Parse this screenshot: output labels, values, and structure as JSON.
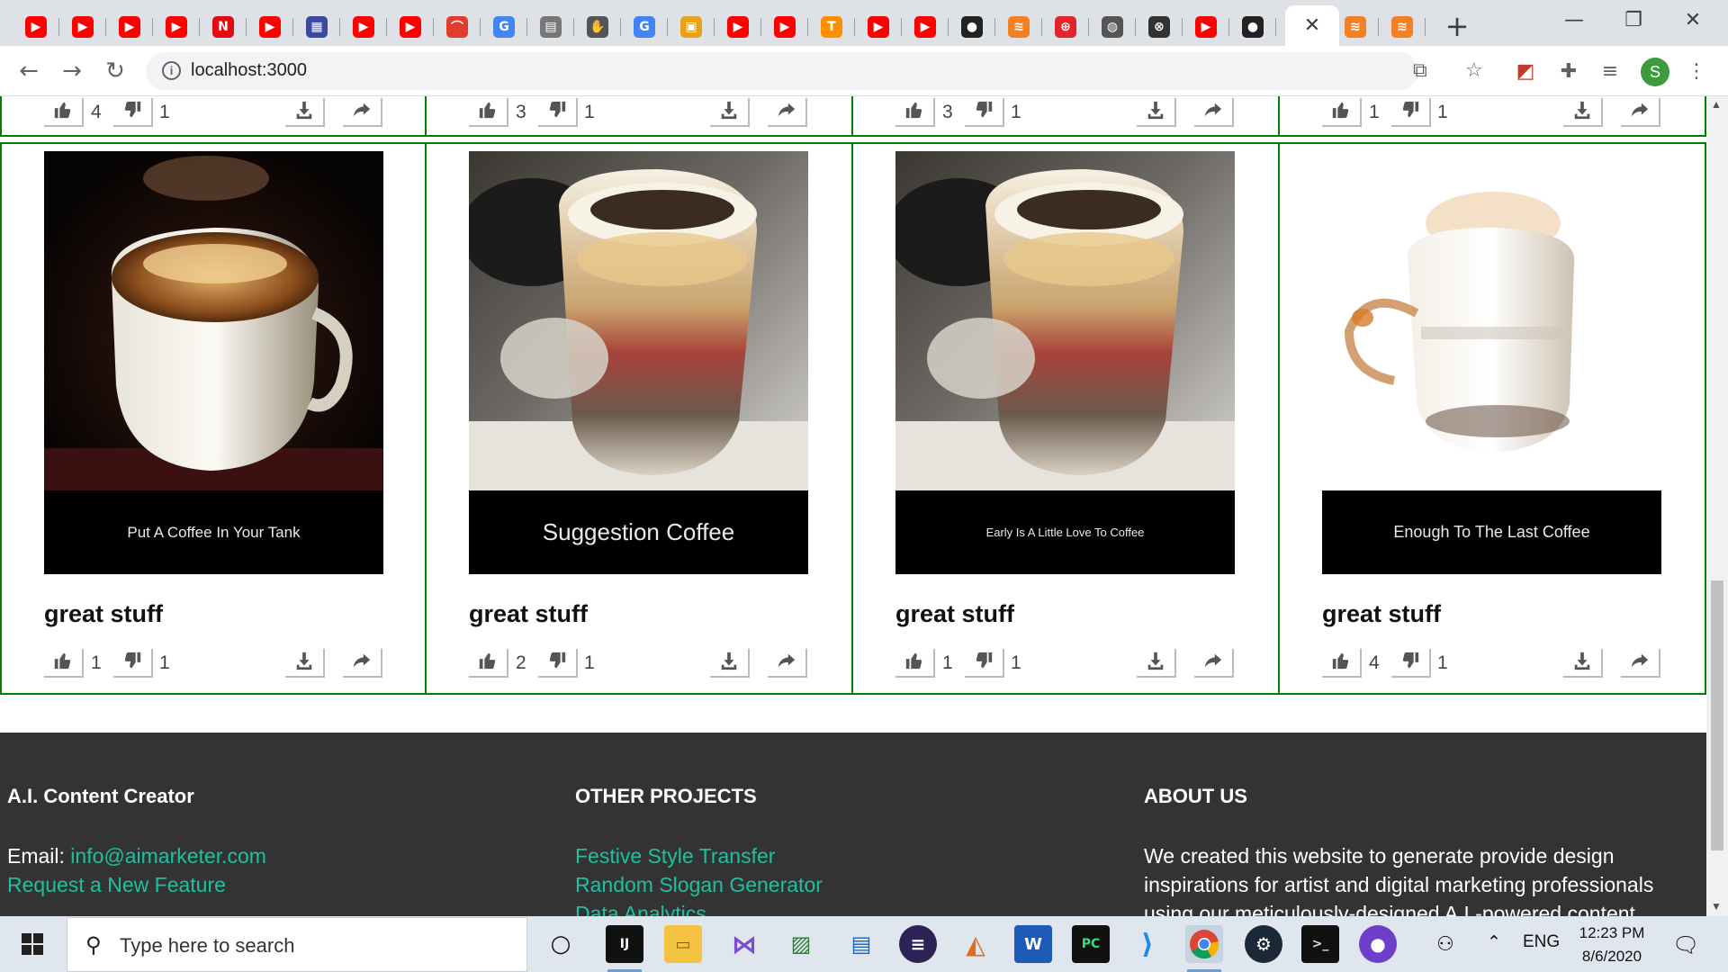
{
  "browser": {
    "tabs": [
      {
        "icon": "youtube-icon",
        "glyph": "▶",
        "color": "#ff0000"
      },
      {
        "icon": "youtube-icon",
        "glyph": "▶",
        "color": "#ff0000"
      },
      {
        "icon": "youtube-icon",
        "glyph": "▶",
        "color": "#ff0000"
      },
      {
        "icon": "youtube-icon",
        "glyph": "▶",
        "color": "#ff0000"
      },
      {
        "icon": "netflix-icon",
        "glyph": "N",
        "color": "#e50914"
      },
      {
        "icon": "youtube-icon",
        "glyph": "▶",
        "color": "#ff0000"
      },
      {
        "icon": "calendar-icon",
        "glyph": "▦",
        "color": "#3b4a9c"
      },
      {
        "icon": "youtube-icon",
        "glyph": "▶",
        "color": "#ff0000"
      },
      {
        "icon": "youtube-icon",
        "glyph": "▶",
        "color": "#ff0000"
      },
      {
        "icon": "bookmark-red-icon",
        "glyph": "⌒",
        "color": "#e33b2e"
      },
      {
        "icon": "google-icon",
        "glyph": "G",
        "color": "#4285f4"
      },
      {
        "icon": "extension-page-icon",
        "glyph": "▤",
        "color": "#777777"
      },
      {
        "icon": "puzzle-icon",
        "glyph": "✋",
        "color": "#555555"
      },
      {
        "icon": "google-icon",
        "glyph": "G",
        "color": "#4285f4"
      },
      {
        "icon": "colorful-grid-icon",
        "glyph": "▣",
        "color": "#e8a21a"
      },
      {
        "icon": "youtube-icon",
        "glyph": "▶",
        "color": "#ff0000"
      },
      {
        "icon": "youtube-icon",
        "glyph": "▶",
        "color": "#ff0000"
      },
      {
        "icon": "tensorflow-icon",
        "glyph": "T",
        "color": "#ff8f00"
      },
      {
        "icon": "youtube-icon",
        "glyph": "▶",
        "color": "#ff0000"
      },
      {
        "icon": "youtube-icon",
        "glyph": "▶",
        "color": "#ff0000"
      },
      {
        "icon": "github-icon",
        "glyph": "●",
        "color": "#222222"
      },
      {
        "icon": "stackoverflow-icon",
        "glyph": "≋",
        "color": "#f48024"
      },
      {
        "icon": "lifebuoy-icon",
        "glyph": "⊕",
        "color": "#e3242b"
      },
      {
        "icon": "globe-icon",
        "glyph": "◍",
        "color": "#555555"
      },
      {
        "icon": "x-circle-icon",
        "glyph": "⊗",
        "color": "#333333"
      },
      {
        "icon": "youtube-icon",
        "glyph": "▶",
        "color": "#ff0000"
      },
      {
        "icon": "github-icon",
        "glyph": "●",
        "color": "#222222"
      },
      {
        "icon": "close-tab-icon",
        "glyph": "✕",
        "color": "#3c4043",
        "active": true
      },
      {
        "icon": "stackoverflow-icon",
        "glyph": "≋",
        "color": "#f48024"
      },
      {
        "icon": "stackoverflow-icon",
        "glyph": "≋",
        "color": "#f48024"
      }
    ],
    "url": "localhost:3000"
  },
  "top_row": [
    {
      "likes": "4",
      "dislikes": "1"
    },
    {
      "likes": "3",
      "dislikes": "1"
    },
    {
      "likes": "3",
      "dislikes": "1"
    },
    {
      "likes": "1",
      "dislikes": "1"
    }
  ],
  "cards": [
    {
      "caption": "Put A Coffee In Your Tank",
      "title": "great stuff",
      "likes": "1",
      "dislikes": "1",
      "style": "dark"
    },
    {
      "caption": "Suggestion Coffee",
      "title": "great stuff",
      "likes": "2",
      "dislikes": "1",
      "style": "glass"
    },
    {
      "caption": "Early Is A Little Love To Coffee",
      "title": "great stuff",
      "likes": "1",
      "dislikes": "1",
      "style": "glass"
    },
    {
      "caption": "Enough To The Last Coffee",
      "title": "great stuff",
      "likes": "4",
      "dislikes": "1",
      "style": "light"
    }
  ],
  "footer": {
    "col1": {
      "heading": "A.I. Content Creator",
      "email_label": "Email: ",
      "email": "info@aimarketer.com",
      "request": "Request a New Feature"
    },
    "col2": {
      "heading": "OTHER PROJECTS",
      "links": [
        "Festive Style Transfer",
        "Random Slogan Generator",
        "Data Analytics"
      ]
    },
    "col3": {
      "heading": "ABOUT US",
      "lines": [
        "We created this website to generate provide design",
        "inspirations for artist and digital marketing professionals",
        "using our meticulously-designed A.I.-powered content"
      ]
    }
  },
  "taskbar": {
    "search_placeholder": "Type here to search",
    "lang": "ENG",
    "time": "12:23 PM",
    "date": "8/6/2020"
  },
  "colors": {
    "card_border": "#008000",
    "footer_bg": "#333333",
    "link": "#1fc0a0"
  }
}
